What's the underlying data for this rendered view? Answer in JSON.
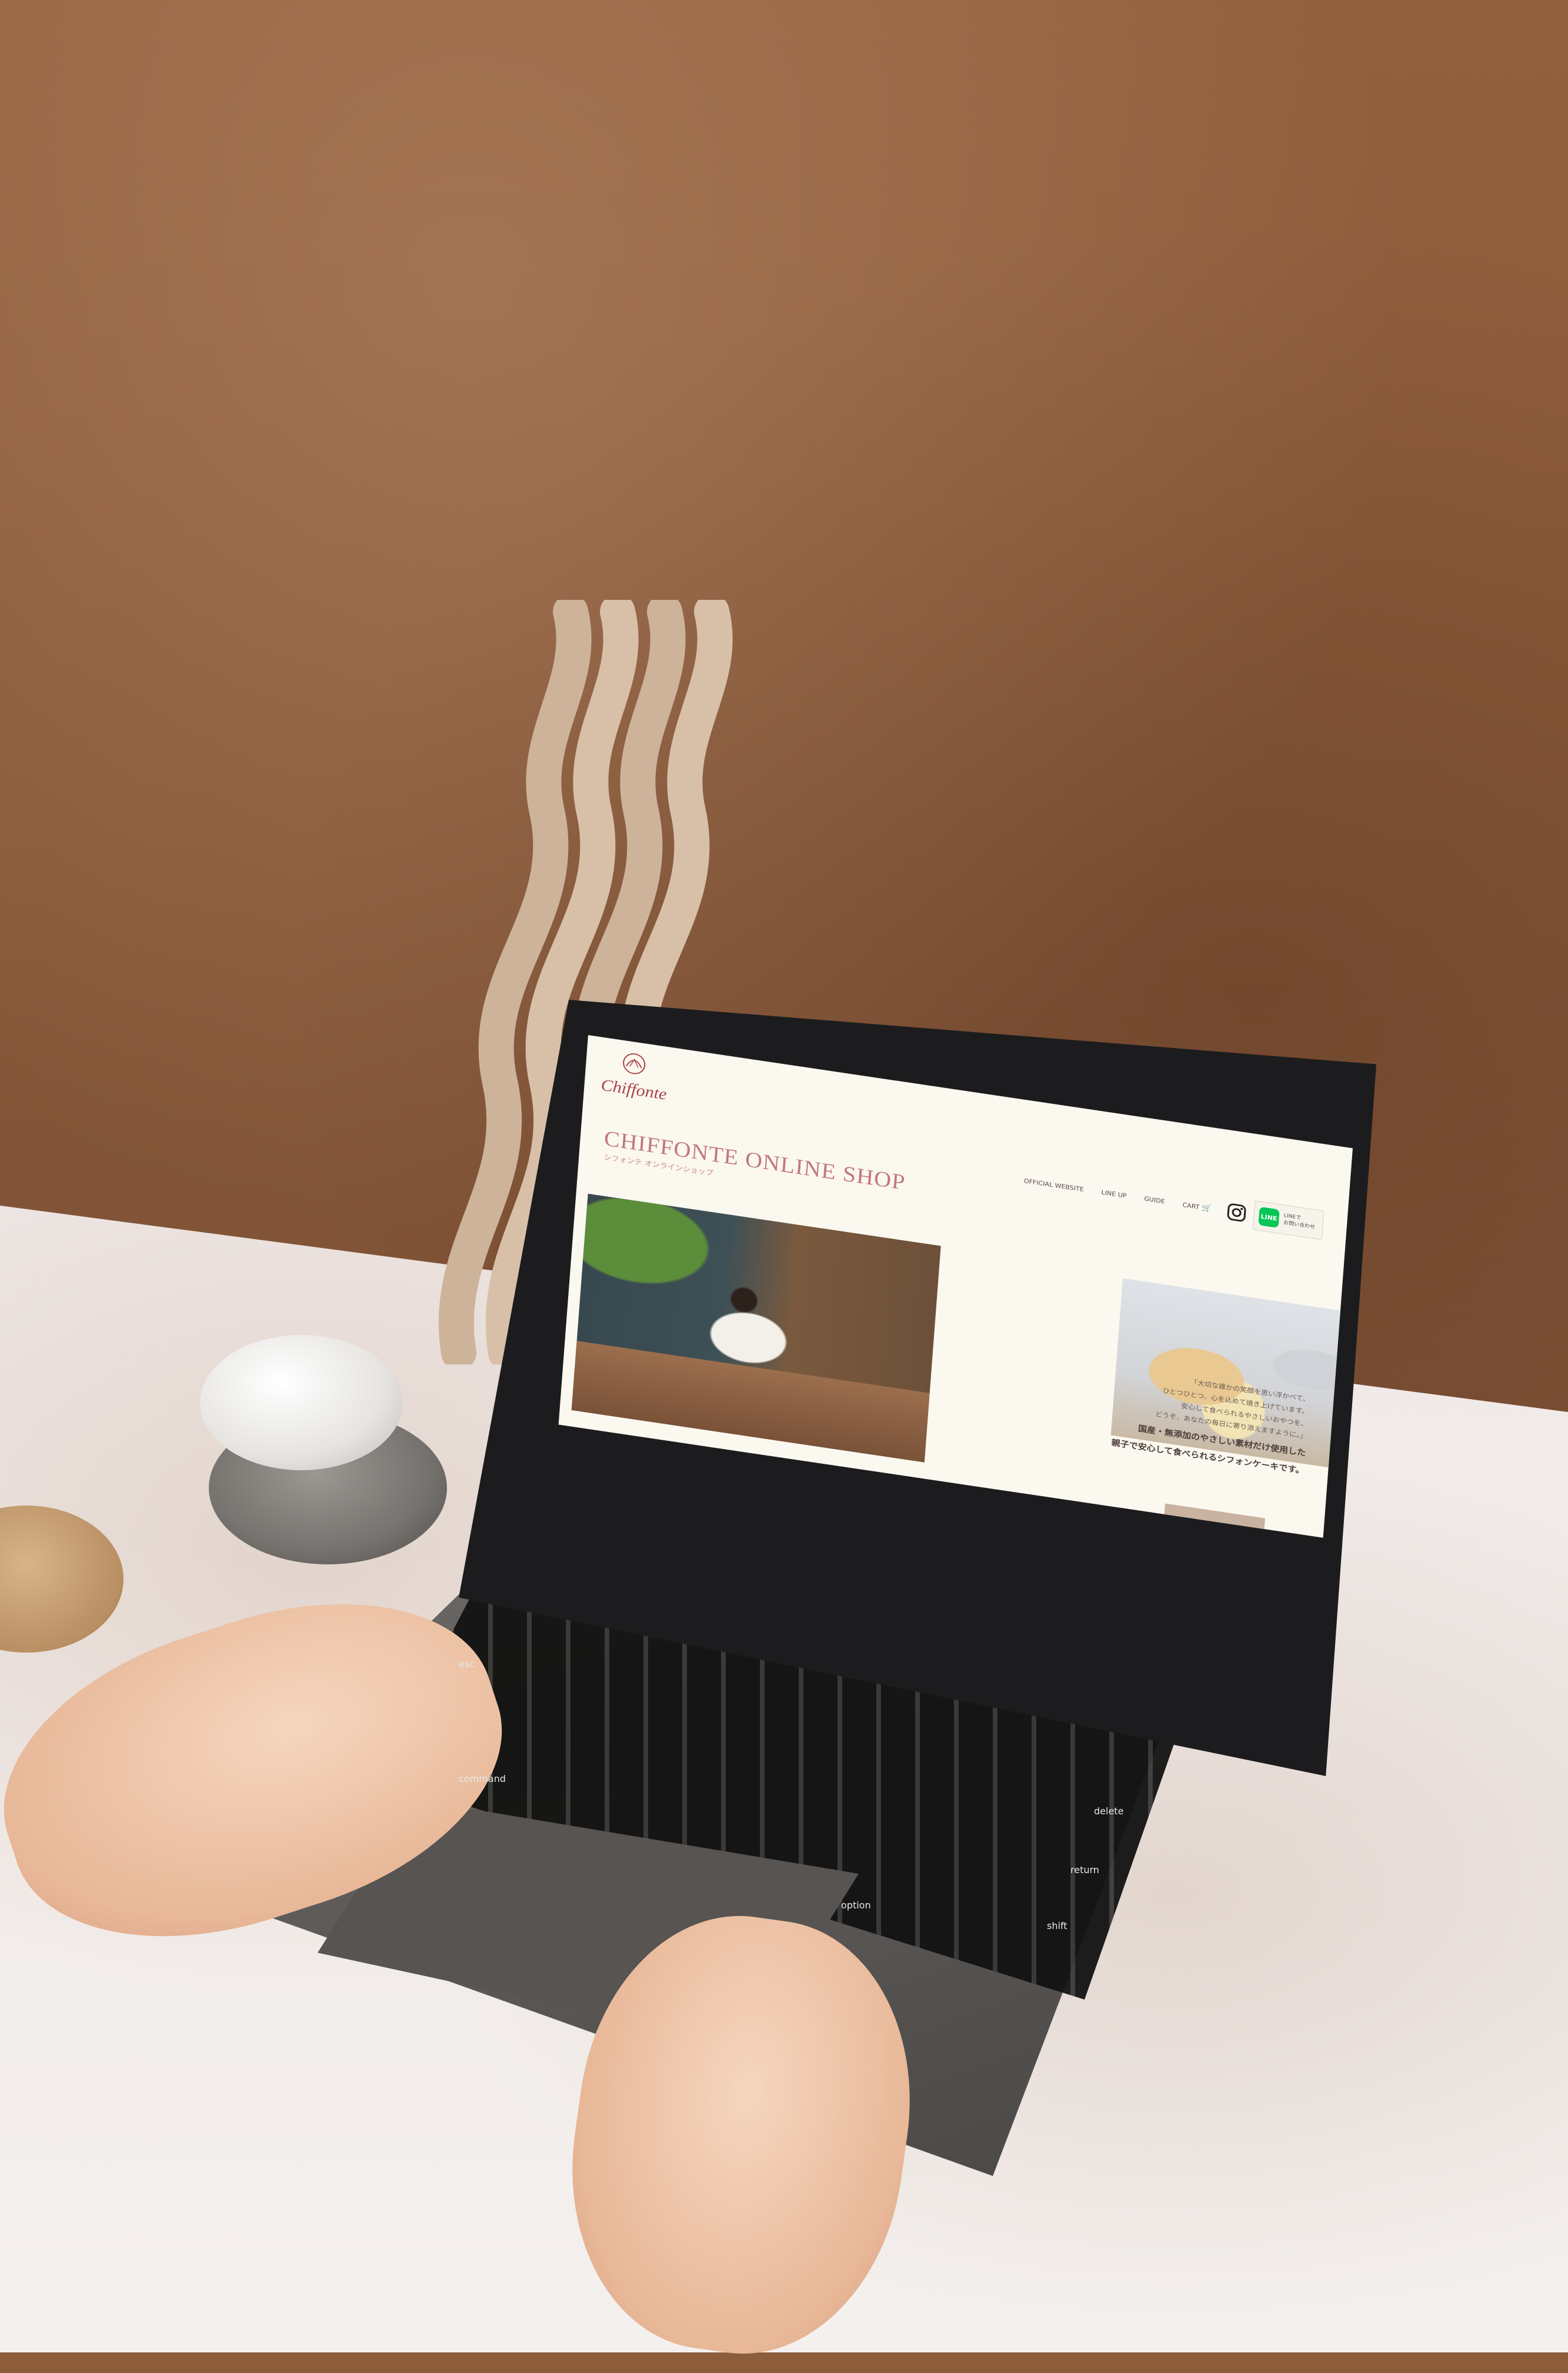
{
  "site": {
    "logo_text": "Chiffonte",
    "title": "CHIFFONTE ONLINE SHOP",
    "subtitle": "シフォンテ オンラインショップ",
    "nav": [
      "OFFICIAL WEBSITE",
      "LINE UP",
      "GUIDE",
      "CART"
    ],
    "line_button": {
      "icon_label": "LINE",
      "line1": "LINEで",
      "line2": "お問い合わせ"
    },
    "copy": {
      "lines": [
        "「大切な誰かの笑顔を思い浮かべて、",
        "ひとつひとつ、心を込めて焼き上げています。",
        "安心して食べられるやさしいおやつを、",
        "どうぞ、あなたの毎日に寄り添えますように。」"
      ],
      "bold_lines": [
        "国産・無添加のやさしい素材だけ使用した",
        "親子で安心して食べられるシフォンケーキです。"
      ]
    }
  },
  "keyboard": {
    "labels": [
      "esc",
      "command",
      "option",
      "delete",
      "return",
      "shift"
    ]
  },
  "colors": {
    "wall": "#8d5c3b",
    "screen_bg": "#fbf8ef",
    "accent": "#c07880",
    "line_green": "#06c755"
  },
  "icons": [
    "cart-icon",
    "instagram-icon",
    "line-icon",
    "chiffonte-logo-mark"
  ]
}
